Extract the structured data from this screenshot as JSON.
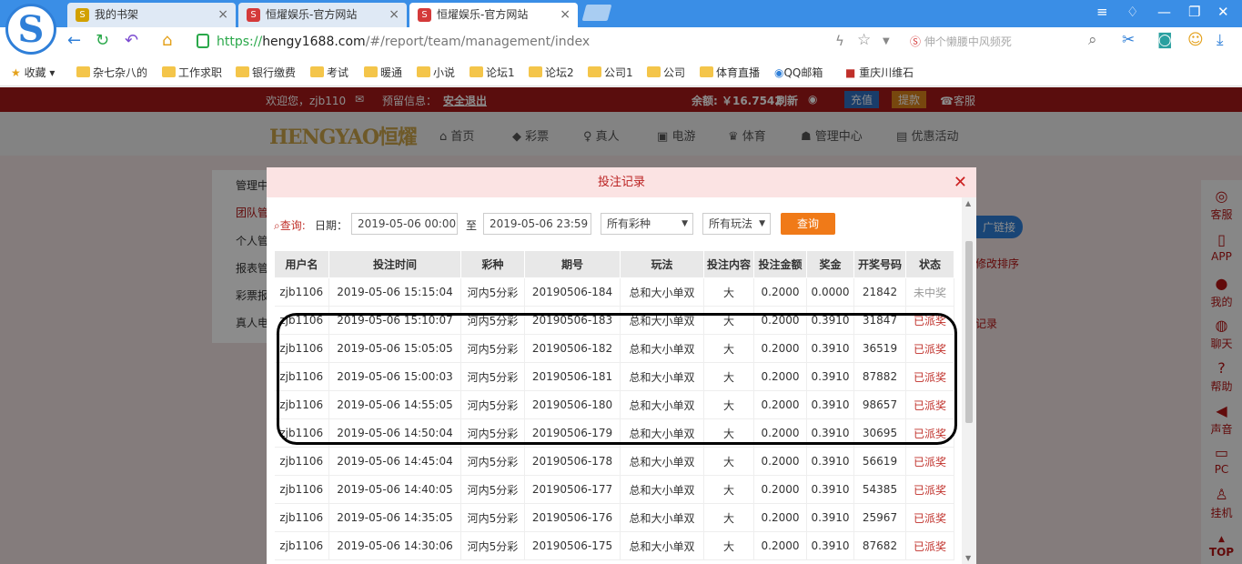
{
  "browser": {
    "tabs": [
      {
        "title": "我的书架",
        "icon_color": "#d2a100",
        "icon": "S"
      },
      {
        "title": "恒燿娱乐-官方网站",
        "icon_color": "#d43a3a",
        "icon": "S"
      },
      {
        "title": "恒燿娱乐-官方网站",
        "icon_color": "#d43a3a",
        "icon": "S"
      }
    ],
    "url": {
      "https": "https://",
      "host": "hengy1688.com",
      "path": "/#/report/team/management/index"
    },
    "search_placeholder": "伸个懒腰中风频死",
    "bookmarks": [
      "收藏",
      "杂七杂八的",
      "工作求职",
      "银行缴费",
      "考试",
      "暖通",
      "小说",
      "论坛1",
      "论坛2",
      "公司1",
      "公司",
      "体育直播",
      "QQ邮箱",
      "重庆川维石"
    ]
  },
  "site": {
    "greeting": "欢迎您，zjb110",
    "warning": "预留信息：",
    "logout": "安全退出",
    "balance": "余额: ￥16.7542",
    "refresh": "刷新",
    "recharge": "充值",
    "withdraw": "提款",
    "service": "客服",
    "logo": "HENGYAO恒燿",
    "nav": [
      "首页",
      "彩票",
      "真人",
      "电游",
      "体育",
      "管理中心",
      "优惠活动"
    ],
    "side_menu": [
      "管理中",
      "团队管",
      "个人管",
      "报表管",
      "彩票报",
      "真人电"
    ],
    "right_rail": [
      "客服",
      "APP",
      "我的",
      "聊天",
      "帮助",
      "声音",
      "PC",
      "挂机",
      "TOP"
    ],
    "bg_text": [
      "广链接",
      "修改排序",
      "记录"
    ]
  },
  "modal": {
    "title": "投注记录",
    "query_label": "查询:",
    "date_label": "日期：",
    "date_from": "2019-05-06 00:00",
    "to_label": "至",
    "date_to": "2019-05-06 23:59",
    "lottery_select": "所有彩种",
    "play_select": "所有玩法",
    "query_button": "查询",
    "columns": [
      "用户名",
      "投注时间",
      "彩种",
      "期号",
      "玩法",
      "投注内容",
      "投注金额",
      "奖金",
      "开奖号码",
      "状态"
    ],
    "rows": [
      [
        "zjb1106",
        "2019-05-06 15:15:04",
        "河内5分彩",
        "20190506-184",
        "总和大小单双",
        "大",
        "0.2000",
        "0.0000",
        "21842",
        "未中奖"
      ],
      [
        "zjb1106",
        "2019-05-06 15:10:07",
        "河内5分彩",
        "20190506-183",
        "总和大小单双",
        "大",
        "0.2000",
        "0.3910",
        "31847",
        "已派奖"
      ],
      [
        "zjb1106",
        "2019-05-06 15:05:05",
        "河内5分彩",
        "20190506-182",
        "总和大小单双",
        "大",
        "0.2000",
        "0.3910",
        "36519",
        "已派奖"
      ],
      [
        "zjb1106",
        "2019-05-06 15:00:03",
        "河内5分彩",
        "20190506-181",
        "总和大小单双",
        "大",
        "0.2000",
        "0.3910",
        "87882",
        "已派奖"
      ],
      [
        "zjb1106",
        "2019-05-06 14:55:05",
        "河内5分彩",
        "20190506-180",
        "总和大小单双",
        "大",
        "0.2000",
        "0.3910",
        "98657",
        "已派奖"
      ],
      [
        "zjb1106",
        "2019-05-06 14:50:04",
        "河内5分彩",
        "20190506-179",
        "总和大小单双",
        "大",
        "0.2000",
        "0.3910",
        "30695",
        "已派奖"
      ],
      [
        "zjb1106",
        "2019-05-06 14:45:04",
        "河内5分彩",
        "20190506-178",
        "总和大小单双",
        "大",
        "0.2000",
        "0.3910",
        "56619",
        "已派奖"
      ],
      [
        "zjb1106",
        "2019-05-06 14:40:05",
        "河内5分彩",
        "20190506-177",
        "总和大小单双",
        "大",
        "0.2000",
        "0.3910",
        "54385",
        "已派奖"
      ],
      [
        "zjb1106",
        "2019-05-06 14:35:05",
        "河内5分彩",
        "20190506-176",
        "总和大小单双",
        "大",
        "0.2000",
        "0.3910",
        "25967",
        "已派奖"
      ],
      [
        "zjb1106",
        "2019-05-06 14:30:06",
        "河内5分彩",
        "20190506-175",
        "总和大小单双",
        "大",
        "0.2000",
        "0.3910",
        "87682",
        "已派奖"
      ]
    ]
  },
  "colors": {
    "brand_red": "#a41818",
    "accent_orange": "#f07a18",
    "won_red": "#c0302a",
    "browser_blue": "#3a8ee6"
  }
}
